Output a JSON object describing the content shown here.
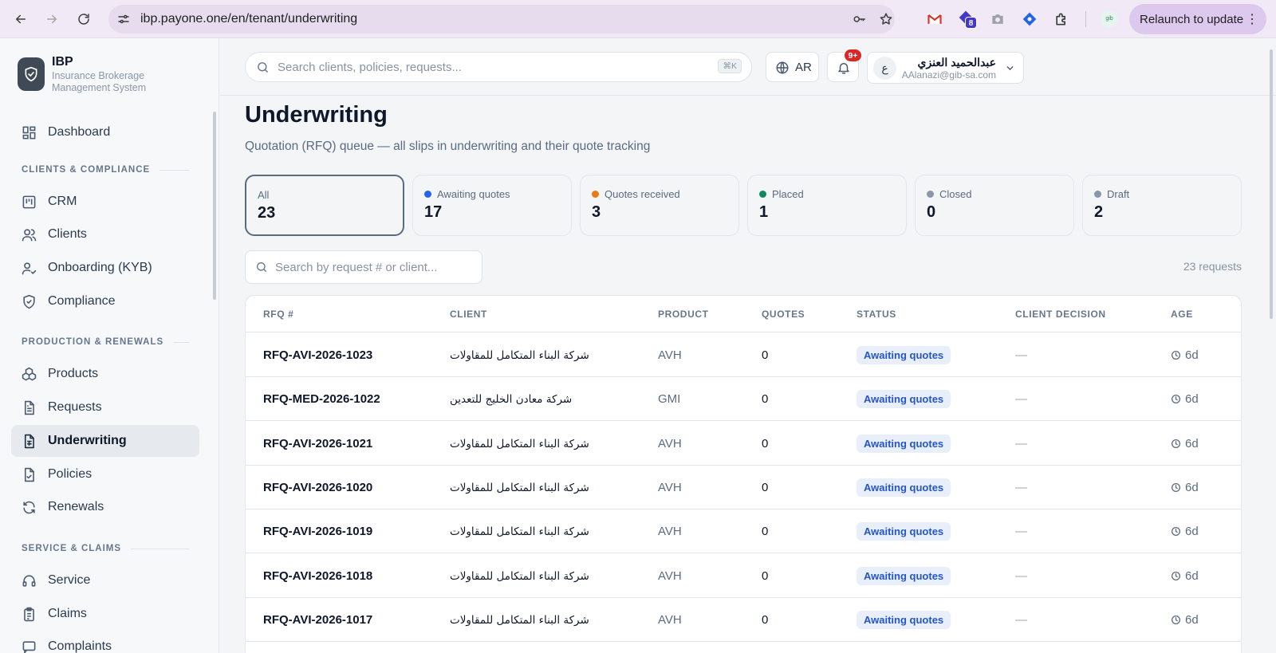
{
  "browser": {
    "url": "ibp.payone.one/en/tenant/underwriting",
    "relaunch_label": "Relaunch to update",
    "extension_badge": "8"
  },
  "brand": {
    "name": "IBP",
    "subtitle": "Insurance Brokerage Management System"
  },
  "sidebar": {
    "dashboard": "Dashboard",
    "sections": [
      {
        "title": "CLIENTS & COMPLIANCE",
        "items": [
          "CRM",
          "Clients",
          "Onboarding (KYB)",
          "Compliance"
        ]
      },
      {
        "title": "PRODUCTION & RENEWALS",
        "items": [
          "Products",
          "Requests",
          "Underwriting",
          "Policies",
          "Renewals"
        ]
      },
      {
        "title": "SERVICE & CLAIMS",
        "items": [
          "Service",
          "Claims",
          "Complaints"
        ]
      }
    ]
  },
  "topbar": {
    "search_placeholder": "Search clients, policies, requests...",
    "search_shortcut": "⌘K",
    "language": "AR",
    "notif_count": "9+",
    "user_initial": "ع",
    "user_name": "عبدالحميد العنزي",
    "user_email": "AAlanazi@gib-sa.com"
  },
  "page": {
    "title": "Underwriting",
    "subtitle": "Quotation (RFQ) queue — all slips in underwriting and their quote tracking",
    "table_search_placeholder": "Search by request # or client...",
    "request_count": "23 requests"
  },
  "stats": [
    {
      "label": "All",
      "value": "23",
      "color": ""
    },
    {
      "label": "Awaiting quotes",
      "value": "17",
      "color": "#2563eb"
    },
    {
      "label": "Quotes received",
      "value": "3",
      "color": "#ea7a12"
    },
    {
      "label": "Placed",
      "value": "1",
      "color": "#0f8a5f"
    },
    {
      "label": "Closed",
      "value": "0",
      "color": "#8a97a8"
    },
    {
      "label": "Draft",
      "value": "2",
      "color": "#8a97a8"
    }
  ],
  "table": {
    "headers": [
      "RFQ #",
      "CLIENT",
      "PRODUCT",
      "QUOTES",
      "STATUS",
      "CLIENT DECISION",
      "AGE"
    ],
    "rows": [
      {
        "rfq": "RFQ-AVI-2026-1023",
        "client": "شركة البناء المتكامل للمقاولات",
        "product": "AVH",
        "quotes": "0",
        "status": "Awaiting quotes",
        "decision": "—",
        "age": "6d"
      },
      {
        "rfq": "RFQ-MED-2026-1022",
        "client": "شركة معادن الخليج للتعدين",
        "product": "GMI",
        "quotes": "0",
        "status": "Awaiting quotes",
        "decision": "—",
        "age": "6d"
      },
      {
        "rfq": "RFQ-AVI-2026-1021",
        "client": "شركة البناء المتكامل للمقاولات",
        "product": "AVH",
        "quotes": "0",
        "status": "Awaiting quotes",
        "decision": "—",
        "age": "6d"
      },
      {
        "rfq": "RFQ-AVI-2026-1020",
        "client": "شركة البناء المتكامل للمقاولات",
        "product": "AVH",
        "quotes": "0",
        "status": "Awaiting quotes",
        "decision": "—",
        "age": "6d"
      },
      {
        "rfq": "RFQ-AVI-2026-1019",
        "client": "شركة البناء المتكامل للمقاولات",
        "product": "AVH",
        "quotes": "0",
        "status": "Awaiting quotes",
        "decision": "—",
        "age": "6d"
      },
      {
        "rfq": "RFQ-AVI-2026-1018",
        "client": "شركة البناء المتكامل للمقاولات",
        "product": "AVH",
        "quotes": "0",
        "status": "Awaiting quotes",
        "decision": "—",
        "age": "6d"
      },
      {
        "rfq": "RFQ-AVI-2026-1017",
        "client": "شركة البناء المتكامل للمقاولات",
        "product": "AVH",
        "quotes": "0",
        "status": "Awaiting quotes",
        "decision": "—",
        "age": "6d"
      }
    ]
  }
}
